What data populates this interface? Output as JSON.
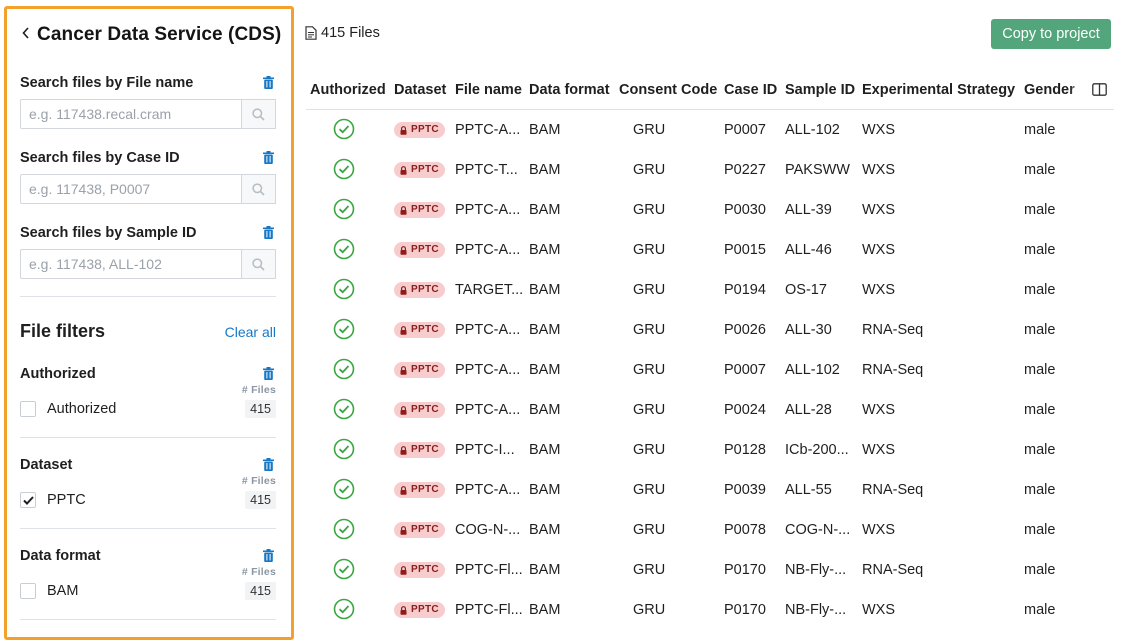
{
  "sidebar": {
    "title": "Cancer Data Service (CDS)",
    "back_icon": "chevron-left-icon",
    "search_file_name": {
      "label": "Search files by File name",
      "placeholder": "e.g. 117438.recal.cram"
    },
    "search_case_id": {
      "label": "Search files by Case ID",
      "placeholder": "e.g. 117438, P0007"
    },
    "search_sample_id": {
      "label": "Search files by Sample ID",
      "placeholder": "e.g. 117438, ALL-102"
    },
    "filters_title": "File filters",
    "clear_all": "Clear all",
    "facets": [
      {
        "title": "Authorized",
        "files_header": "# Files",
        "option": "Authorized",
        "count": "415",
        "checked": false
      },
      {
        "title": "Dataset",
        "files_header": "# Files",
        "option": "PPTC",
        "count": "415",
        "checked": true
      },
      {
        "title": "Data format",
        "files_header": "# Files",
        "option": "BAM",
        "count": "415",
        "checked": false
      }
    ]
  },
  "header": {
    "files_count": "415 Files",
    "copy_button": "Copy to project"
  },
  "table": {
    "columns": [
      "Authorized",
      "Dataset",
      "File name",
      "Data format",
      "Consent Code",
      "Case ID",
      "Sample ID",
      "Experimental Strategy",
      "Gender"
    ],
    "badge_label": "PPTC",
    "rows": [
      {
        "file_name": "PPTC-A...",
        "format": "BAM",
        "consent": "GRU",
        "case_id": "P0007",
        "sample_id": "ALL-102",
        "strategy": "WXS",
        "gender": "male"
      },
      {
        "file_name": "PPTC-T...",
        "format": "BAM",
        "consent": "GRU",
        "case_id": "P0227",
        "sample_id": "PAKSWW",
        "strategy": "WXS",
        "gender": "male"
      },
      {
        "file_name": "PPTC-A...",
        "format": "BAM",
        "consent": "GRU",
        "case_id": "P0030",
        "sample_id": "ALL-39",
        "strategy": "WXS",
        "gender": "male"
      },
      {
        "file_name": "PPTC-A...",
        "format": "BAM",
        "consent": "GRU",
        "case_id": "P0015",
        "sample_id": "ALL-46",
        "strategy": "WXS",
        "gender": "male"
      },
      {
        "file_name": "TARGET...",
        "format": "BAM",
        "consent": "GRU",
        "case_id": "P0194",
        "sample_id": "OS-17",
        "strategy": "WXS",
        "gender": "male"
      },
      {
        "file_name": "PPTC-A...",
        "format": "BAM",
        "consent": "GRU",
        "case_id": "P0026",
        "sample_id": "ALL-30",
        "strategy": "RNA-Seq",
        "gender": "male"
      },
      {
        "file_name": "PPTC-A...",
        "format": "BAM",
        "consent": "GRU",
        "case_id": "P0007",
        "sample_id": "ALL-102",
        "strategy": "RNA-Seq",
        "gender": "male"
      },
      {
        "file_name": "PPTC-A...",
        "format": "BAM",
        "consent": "GRU",
        "case_id": "P0024",
        "sample_id": "ALL-28",
        "strategy": "WXS",
        "gender": "male"
      },
      {
        "file_name": "PPTC-I...",
        "format": "BAM",
        "consent": "GRU",
        "case_id": "P0128",
        "sample_id": "ICb-200...",
        "strategy": "WXS",
        "gender": "male"
      },
      {
        "file_name": "PPTC-A...",
        "format": "BAM",
        "consent": "GRU",
        "case_id": "P0039",
        "sample_id": "ALL-55",
        "strategy": "RNA-Seq",
        "gender": "male"
      },
      {
        "file_name": "COG-N-...",
        "format": "BAM",
        "consent": "GRU",
        "case_id": "P0078",
        "sample_id": "COG-N-...",
        "strategy": "WXS",
        "gender": "male"
      },
      {
        "file_name": "PPTC-Fl...",
        "format": "BAM",
        "consent": "GRU",
        "case_id": "P0170",
        "sample_id": "NB-Fly-...",
        "strategy": "RNA-Seq",
        "gender": "male"
      },
      {
        "file_name": "PPTC-Fl...",
        "format": "BAM",
        "consent": "GRU",
        "case_id": "P0170",
        "sample_id": "NB-Fly-...",
        "strategy": "WXS",
        "gender": "male"
      }
    ]
  },
  "colors": {
    "accent": "#f4a12b",
    "link": "#1677c6",
    "primary_button": "#53a67b",
    "authorized_check": "#3aa640",
    "badge_bg": "#f7cccc",
    "badge_text": "#8b1d1d"
  }
}
